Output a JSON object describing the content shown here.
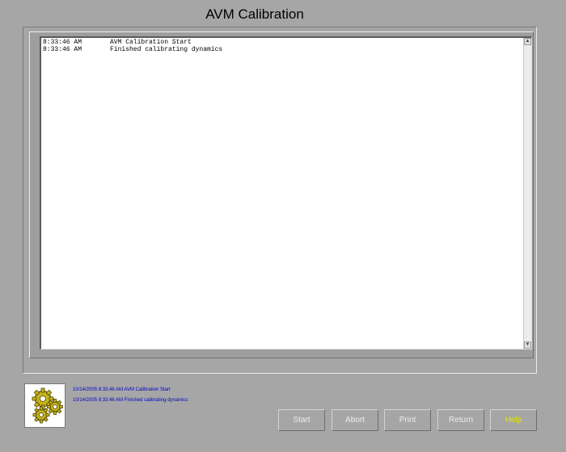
{
  "window": {
    "title": "AVM Calibration"
  },
  "log": {
    "lines": [
      {
        "time": "8:33:46 AM",
        "message": "AVM Calibration Start"
      },
      {
        "time": "8:33:46 AM",
        "message": "Finished calibrating dynamics"
      }
    ]
  },
  "status": {
    "lines": [
      "10/14/2005 8:33:46 AM AVM Calibration Start",
      "10/14/2005 8:33:46 AM Finished calibrating dynamics"
    ],
    "color": "#0000cc"
  },
  "icon": {
    "name": "gears-icon",
    "color": "#c8b420"
  },
  "buttons": {
    "start": "Start",
    "abort": "Abort",
    "print": "Print",
    "return": "Return",
    "help": "Help"
  },
  "colors": {
    "background": "#a6a6a6",
    "help_text": "#e6e600",
    "button_text": "#ececec"
  }
}
